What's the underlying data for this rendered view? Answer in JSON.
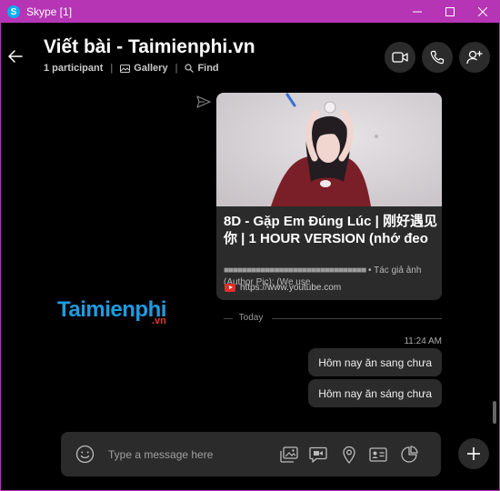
{
  "window": {
    "title": "Skype [1]",
    "app_icon_letter": "S",
    "accent": "#b535b5"
  },
  "header": {
    "title": "Viết bài - Taimienphi.vn",
    "participants": "1 participant",
    "gallery": "Gallery",
    "find": "Find"
  },
  "card": {
    "title": "8D - Gặp Em Đúng Lúc | 刚好遇见你 | 1 HOUR VERSION (nhớ đeo",
    "desc_blocks": "■■■■■■■■■■■■■■■■■■■■■■■■■■■■■■■",
    "desc_text": "• Tác giả ảnh (Author Pic): (We use",
    "link": "https://www.youtube.com"
  },
  "watermark": {
    "text": "Taimienphi",
    "suffix": ".vn"
  },
  "divider": {
    "label": "Today"
  },
  "messages": {
    "time": "11:24 AM",
    "items": [
      {
        "text": "Hôm nay ăn sang chưa"
      },
      {
        "text": "Hôm nay ăn sáng chưa"
      }
    ]
  },
  "composer": {
    "placeholder": "Type a message here"
  },
  "icons": {
    "back": "arrow-left-icon",
    "video_call": "video-camera-icon",
    "audio_call": "phone-icon",
    "add_person": "add-person-icon",
    "emoji": "emoji-icon",
    "gallery": "image-gallery-icon",
    "video_message": "video-message-icon",
    "location": "location-pin-icon",
    "contact": "contact-card-icon",
    "poll": "poll-chart-icon",
    "add": "plus-icon"
  }
}
